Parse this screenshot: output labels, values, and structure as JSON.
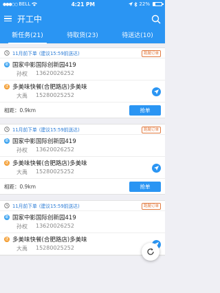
{
  "status_bar": {
    "carrier": "BELL",
    "time": "4:21 PM",
    "battery_percent": "22%",
    "battery_level": 0.22
  },
  "nav": {
    "title": "开工中"
  },
  "tabs": [
    {
      "label": "新任务(21)",
      "active": true
    },
    {
      "label": "待取货(23)",
      "active": false
    },
    {
      "label": "待送达(10)",
      "active": false
    }
  ],
  "orders": [
    {
      "time": "11月前下单",
      "suggest": "(建议15:59前送达)",
      "tag": "跑腿订单",
      "pickup": {
        "badge": "取",
        "name": "国家中影国际创新园419",
        "contact": "孙权",
        "phone": "13620026252"
      },
      "dropoff": {
        "badge": "送",
        "name": "多美味快餐(合肥路店)多美味",
        "contact": "大禹",
        "phone": "15280025252"
      },
      "distance": "相距：0.9km",
      "action": "抢单"
    },
    {
      "time": "11月前下单",
      "suggest": "(建议15:59前送达)",
      "tag": "跑腿订单",
      "pickup": {
        "badge": "取",
        "name": "国家中影国际创新园419",
        "contact": "孙权",
        "phone": "13620026252"
      },
      "dropoff": {
        "badge": "送",
        "name": "多美味快餐(合肥路店)多美味",
        "contact": "大禹",
        "phone": "15280025252"
      },
      "distance": "相距：0.9km",
      "action": "抢单"
    },
    {
      "time": "11月前下单",
      "suggest": "(建议15:59前送达)",
      "tag": "跑腿订单",
      "pickup": {
        "badge": "取",
        "name": "国家中影国际创新园419",
        "contact": "孙权",
        "phone": "13620026252"
      },
      "dropoff": {
        "badge": "送",
        "name": "多美味快餐(合肥路店)多美味",
        "contact": "大禹",
        "phone": "15280025252"
      },
      "distance": "",
      "action": ""
    }
  ],
  "icons": {
    "menu": "hamburger-icon",
    "search": "search-icon",
    "clock": "clock-icon",
    "navigate": "navigation-arrow-icon",
    "refresh": "refresh-icon"
  },
  "colors": {
    "primary": "#2a95f3",
    "tag": "#e27a3f",
    "pickup_badge": "#3ba3f0",
    "dropoff_badge": "#f39b2d"
  }
}
